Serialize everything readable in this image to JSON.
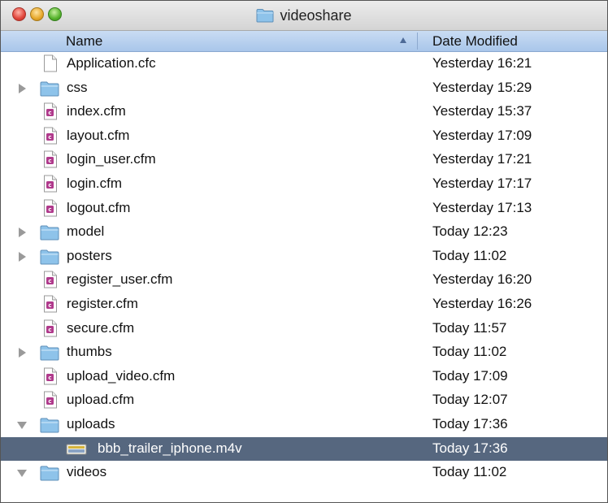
{
  "window": {
    "title": "videoshare"
  },
  "columns": {
    "name": "Name",
    "date": "Date Modified"
  },
  "rows": [
    {
      "name": "Application.cfc",
      "date": "Yesterday 16:21",
      "kind": "file-plain",
      "disclosure": "none",
      "level": 0
    },
    {
      "name": "css",
      "date": "Yesterday 15:29",
      "kind": "folder",
      "disclosure": "closed",
      "level": 0
    },
    {
      "name": "index.cfm",
      "date": "Yesterday 15:37",
      "kind": "file-cfm",
      "disclosure": "none",
      "level": 0
    },
    {
      "name": "layout.cfm",
      "date": "Yesterday 17:09",
      "kind": "file-cfm",
      "disclosure": "none",
      "level": 0
    },
    {
      "name": "login_user.cfm",
      "date": "Yesterday 17:21",
      "kind": "file-cfm",
      "disclosure": "none",
      "level": 0
    },
    {
      "name": "login.cfm",
      "date": "Yesterday 17:17",
      "kind": "file-cfm",
      "disclosure": "none",
      "level": 0
    },
    {
      "name": "logout.cfm",
      "date": "Yesterday 17:13",
      "kind": "file-cfm",
      "disclosure": "none",
      "level": 0
    },
    {
      "name": "model",
      "date": "Today 12:23",
      "kind": "folder",
      "disclosure": "closed",
      "level": 0
    },
    {
      "name": "posters",
      "date": "Today 11:02",
      "kind": "folder",
      "disclosure": "closed",
      "level": 0
    },
    {
      "name": "register_user.cfm",
      "date": "Yesterday 16:20",
      "kind": "file-cfm",
      "disclosure": "none",
      "level": 0
    },
    {
      "name": "register.cfm",
      "date": "Yesterday 16:26",
      "kind": "file-cfm",
      "disclosure": "none",
      "level": 0
    },
    {
      "name": "secure.cfm",
      "date": "Today 11:57",
      "kind": "file-cfm",
      "disclosure": "none",
      "level": 0
    },
    {
      "name": "thumbs",
      "date": "Today 11:02",
      "kind": "folder",
      "disclosure": "closed",
      "level": 0
    },
    {
      "name": "upload_video.cfm",
      "date": "Today 17:09",
      "kind": "file-cfm",
      "disclosure": "none",
      "level": 0
    },
    {
      "name": "upload.cfm",
      "date": "Today 12:07",
      "kind": "file-cfm",
      "disclosure": "none",
      "level": 0
    },
    {
      "name": "uploads",
      "date": "Today 17:36",
      "kind": "folder",
      "disclosure": "open",
      "level": 0
    },
    {
      "name": "bbb_trailer_iphone.m4v",
      "date": "Today 17:36",
      "kind": "video",
      "disclosure": "none",
      "level": 1,
      "selected": true
    },
    {
      "name": "videos",
      "date": "Today 11:02",
      "kind": "folder",
      "disclosure": "open",
      "level": 0
    }
  ],
  "colors": {
    "selection": "#56677f",
    "header": "#b9d1ef",
    "folder": "#8ec3ea"
  }
}
